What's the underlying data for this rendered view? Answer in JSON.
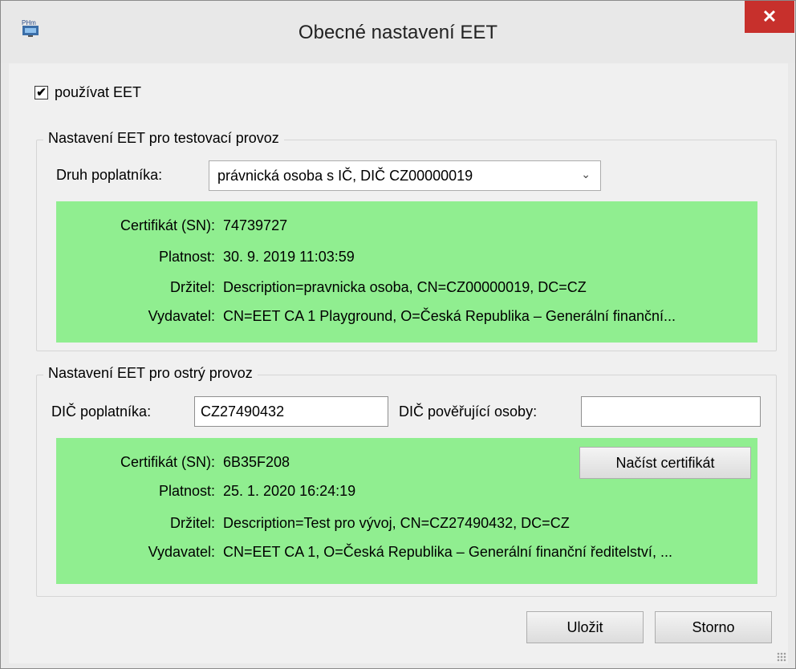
{
  "window": {
    "title": "Obecné nastavení EET",
    "app_icon_text": "PHm",
    "close_glyph": "✕"
  },
  "use_eet": {
    "label": "používat EET",
    "checked": true,
    "check_glyph": "✔"
  },
  "test": {
    "group_title": "Nastavení EET pro testovací provoz",
    "druh_label": "Druh poplatníka:",
    "druh_value": "právnická osoba s IČ, DIČ CZ00000019",
    "cert": {
      "sn_label": "Certifikát (SN):",
      "sn_value": "74739727",
      "platnost_label": "Platnost:",
      "platnost_value": "30. 9. 2019 11:03:59",
      "drzitel_label": "Držitel:",
      "drzitel_value": "Description=pravnicka osoba, CN=CZ00000019, DC=CZ",
      "vydavatel_label": "Vydavatel:",
      "vydavatel_value": "CN=EET CA 1 Playground, O=Česká Republika – Generální finanční..."
    },
    "cert_bg": "#90ee90"
  },
  "live": {
    "group_title": "Nastavení EET pro ostrý provoz",
    "dic_label": "DIČ poplatníka:",
    "dic_value": "CZ27490432",
    "dic_poverujici_label": "DIČ pověřující osoby:",
    "dic_poverujici_value": "",
    "load_cert_button": "Načíst certifikát",
    "cert": {
      "sn_label": "Certifikát (SN):",
      "sn_value": "6B35F208",
      "platnost_label": "Platnost:",
      "platnost_value": "25. 1. 2020 16:24:19",
      "drzitel_label": "Držitel:",
      "drzitel_value": "Description=Test pro vývoj, CN=CZ27490432, DC=CZ",
      "vydavatel_label": "Vydavatel:",
      "vydavatel_value": "CN=EET CA 1, O=Česká Republika – Generální finanční ředitelství, ..."
    }
  },
  "footer": {
    "save_label": "Uložit",
    "cancel_label": "Storno"
  },
  "colors": {
    "close_red": "#c7302c",
    "cert_green": "#90ee90"
  }
}
